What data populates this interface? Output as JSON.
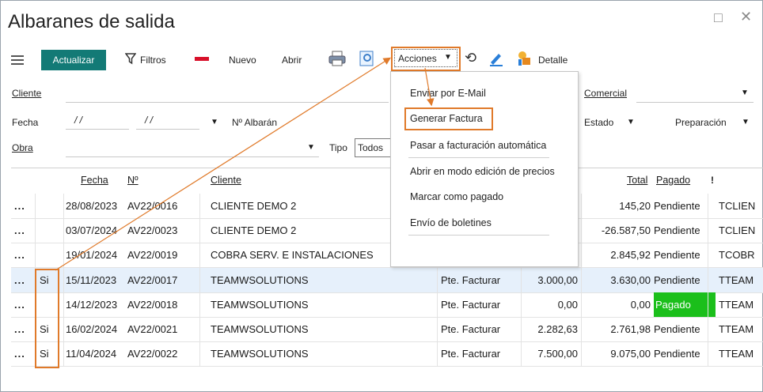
{
  "window": {
    "title": "Albaranes de salida",
    "restore_glyph": "□",
    "close_glyph": "✕"
  },
  "toolbar": {
    "menu_icon": "hamburger-icon",
    "actualizar": "Actualizar",
    "filtros": "Filtros",
    "nuevo": "Nuevo",
    "abrir": "Abrir",
    "acciones": "Acciones",
    "detalle": "Detalle"
  },
  "filters": {
    "cliente_label": "Cliente",
    "fecha_label": "Fecha",
    "fecha_from": "/ /",
    "fecha_to": "/ /",
    "albaran_label": "Nº Albarán",
    "obra_label": "Obra",
    "tipo_label": "Tipo",
    "tipo_value": "Todos",
    "comercial_label": "Comercial",
    "estado_label": "Estado",
    "preparacion_label": "Preparación"
  },
  "acciones_menu": [
    "Enviar por E-Mail",
    "Generar Factura",
    "Pasar a facturación automática",
    "Abrir en modo edición de precios",
    "Marcar como pagado",
    "Envío de boletines"
  ],
  "table": {
    "headers": {
      "fecha": "Fecha",
      "numero": "Nº",
      "cliente": "Cliente",
      "total": "Total",
      "pagado": "Pagado",
      "flag": "!"
    },
    "rows": [
      {
        "dots": "...",
        "si": "",
        "fecha": "28/08/2023",
        "numero": "AV22/0016",
        "cliente": "CLIENTE DEMO 2",
        "estado": "",
        "base": "",
        "total": "145,20",
        "pagado": "Pendiente",
        "code": "TCLIEN"
      },
      {
        "dots": "...",
        "si": "",
        "fecha": "03/07/2024",
        "numero": "AV22/0023",
        "cliente": "CLIENTE DEMO 2",
        "estado": "",
        "base": "",
        "total": "-26.587,50",
        "pagado": "Pendiente",
        "code": "TCLIEN"
      },
      {
        "dots": "...",
        "si": "",
        "fecha": "19/01/2024",
        "numero": "AV22/0019",
        "cliente": "COBRA SERV. E INSTALACIONES",
        "estado": "",
        "base": "",
        "total": "2.845,92",
        "pagado": "Pendiente",
        "code": "TCOBR"
      },
      {
        "dots": "...",
        "si": "Si",
        "fecha": "15/11/2023",
        "numero": "AV22/0017",
        "cliente": "TEAMWSOLUTIONS",
        "estado": "Pte. Facturar",
        "base": "3.000,00",
        "total": "3.630,00",
        "pagado": "Pendiente",
        "code": "TTEAM"
      },
      {
        "dots": "...",
        "si": "",
        "fecha": "14/12/2023",
        "numero": "AV22/0018",
        "cliente": "TEAMWSOLUTIONS",
        "estado": "Pte. Facturar",
        "base": "0,00",
        "total": "0,00",
        "pagado": "Pagado",
        "code": "TTEAM"
      },
      {
        "dots": "...",
        "si": "Si",
        "fecha": "16/02/2024",
        "numero": "AV22/0021",
        "cliente": "TEAMWSOLUTIONS",
        "estado": "Pte. Facturar",
        "base": "2.282,63",
        "total": "2.761,98",
        "pagado": "Pendiente",
        "code": "TTEAM"
      },
      {
        "dots": "...",
        "si": "Si",
        "fecha": "11/04/2024",
        "numero": "AV22/0022",
        "cliente": "TEAMWSOLUTIONS",
        "estado": "Pte. Facturar",
        "base": "7.500,00",
        "total": "9.075,00",
        "pagado": "Pendiente",
        "code": "TTEAM"
      }
    ]
  },
  "colors": {
    "accent": "#137a76",
    "highlight": "#e07a2a",
    "pagado": "#1bbf1b",
    "selected_row": "#e6f0fb"
  }
}
